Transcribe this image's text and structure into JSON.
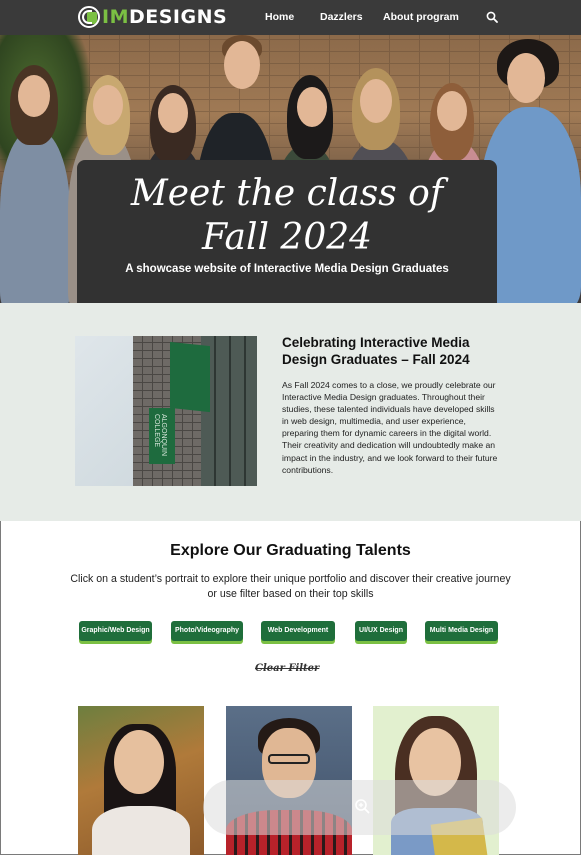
{
  "nav": {
    "logo_prefix": "IM",
    "logo_suffix": "DESIGNS",
    "links": [
      "Home",
      "Dazzlers",
      "About program"
    ],
    "search_icon": "search-icon"
  },
  "hero": {
    "title_line1": "Meet the class of",
    "title_line2": "Fall 2024",
    "subtitle": "A showcase website of Interactive Media Design Graduates"
  },
  "intro": {
    "heading": "Celebrating Interactive Media Design Graduates – Fall 2024",
    "body": "As Fall 2024 comes to a close, we proudly celebrate our Interactive Media Design graduates. Throughout their studies, these talented individuals have developed skills in web design, multimedia, and user experience, preparing them for dynamic careers in the digital world. Their creativity and dedication will undoubtedly make an impact in the industry, and we look forward to their future contributions.",
    "banner_text": "ALGONQUIN COLLEGE"
  },
  "talents": {
    "heading": "Explore Our Graduating Talents",
    "description": "Click on a student’s portrait to explore their unique portfolio and discover their creative journey or use filter based on their top skills",
    "filters": [
      "Graphic/Web Design",
      "Photo/Videography",
      "Web Development",
      "UI/UX Design",
      "Multi Media Design"
    ],
    "clear_filter": "Clear Filter"
  },
  "colors": {
    "nav_bg": "#3a3a3a",
    "accent_green": "#7bc043",
    "button_green": "#1f6e3b",
    "intro_bg": "#e6ebe7"
  }
}
